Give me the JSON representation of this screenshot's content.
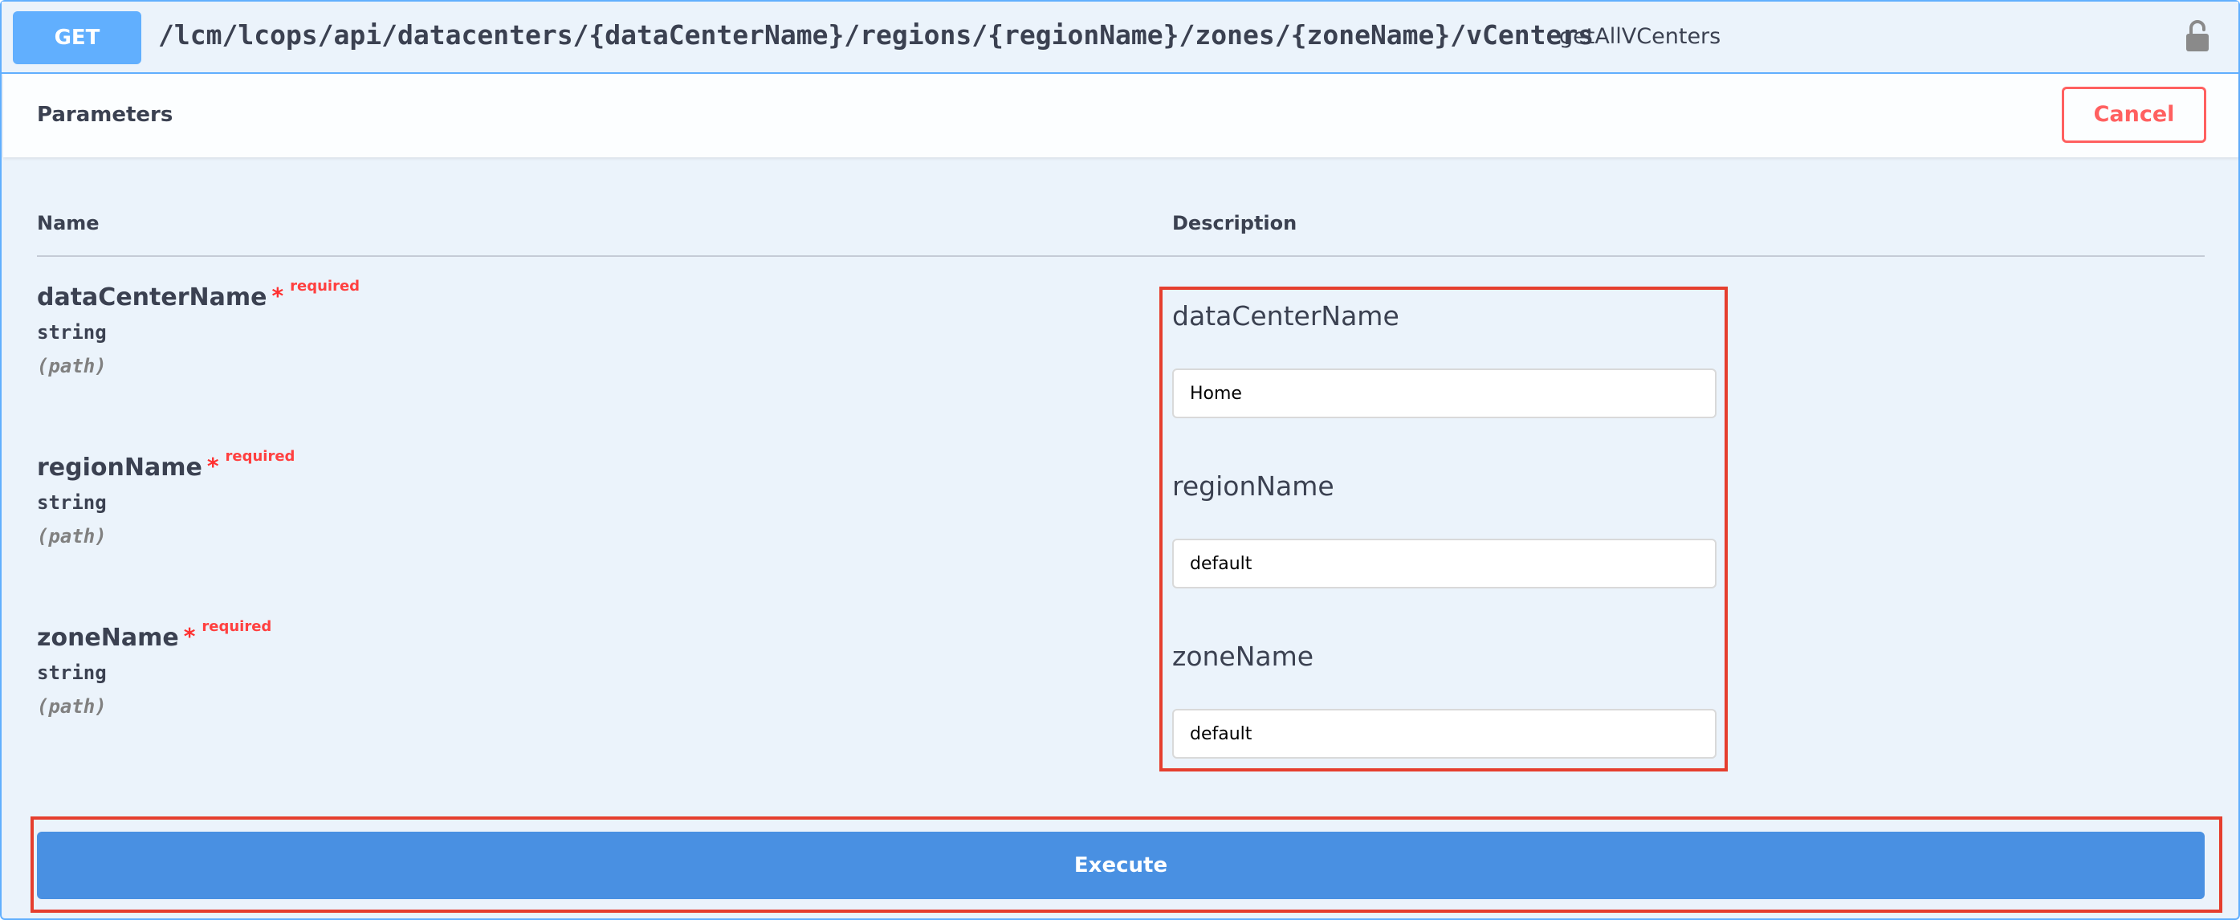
{
  "operation": {
    "method": "GET",
    "path": "/lcm/lcops/api/datacenters/{dataCenterName}/regions/{regionName}/zones/{zoneName}/vCenters",
    "operation_id": "getAllVCenters",
    "lock_icon": "unlocked-padlock-icon"
  },
  "parameters_section": {
    "title": "Parameters",
    "cancel_label": "Cancel"
  },
  "table": {
    "name_header": "Name",
    "description_header": "Description"
  },
  "parameters": [
    {
      "name": "dataCenterName",
      "required_star": "*",
      "required_label": "required",
      "type": "string",
      "in": "(path)",
      "description": "dataCenterName",
      "value": "Home"
    },
    {
      "name": "regionName",
      "required_star": "*",
      "required_label": "required",
      "type": "string",
      "in": "(path)",
      "description": "regionName",
      "value": "default"
    },
    {
      "name": "zoneName",
      "required_star": "*",
      "required_label": "required",
      "type": "string",
      "in": "(path)",
      "description": "zoneName",
      "value": "default"
    }
  ],
  "execute_label": "Execute",
  "colors": {
    "get_accent": "#61affe",
    "background": "#ebf3fb",
    "cancel_red": "#ff6060",
    "execute_blue": "#4990e2",
    "highlight_red": "#e53e2e",
    "text": "#3b4151"
  }
}
